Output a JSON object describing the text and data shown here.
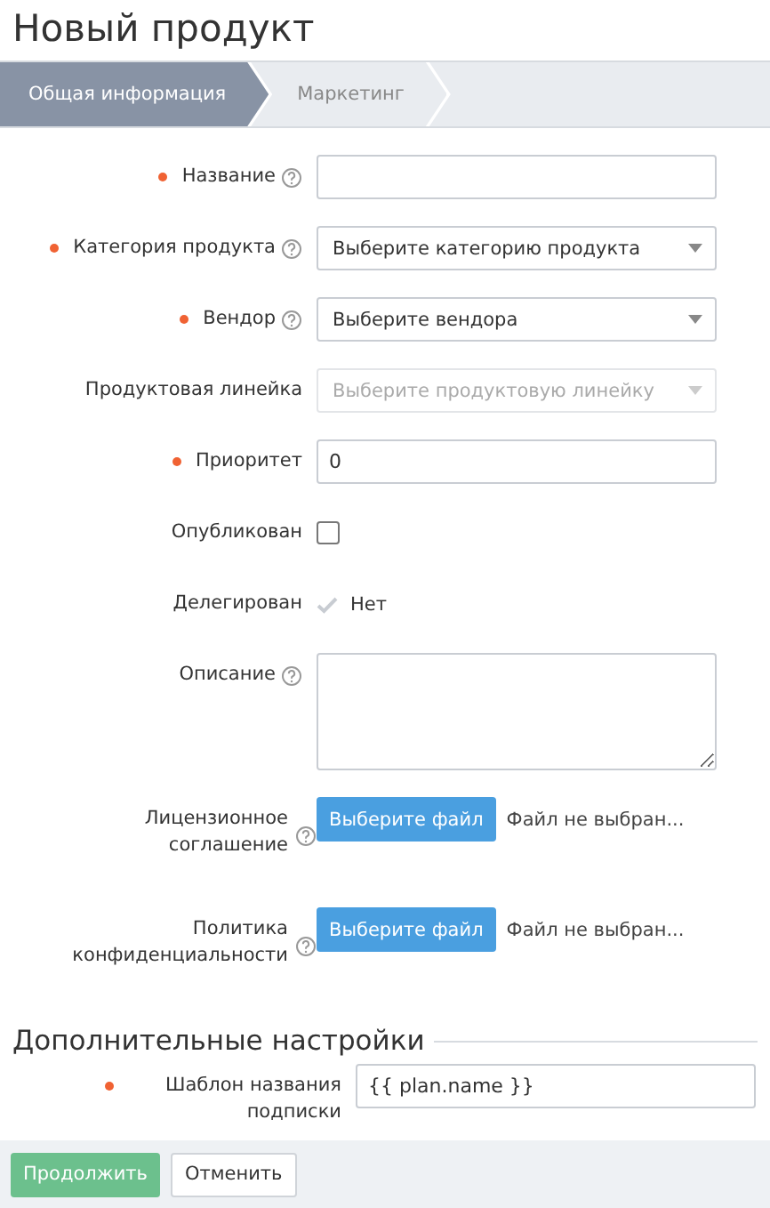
{
  "title": "Новый продукт",
  "steps": [
    {
      "label": "Общая информация",
      "selected": true
    },
    {
      "label": "Маркетинг",
      "selected": false
    }
  ],
  "fields": [
    {
      "kind": "text",
      "label": "Название",
      "required": true,
      "help": true
    },
    {
      "kind": "select",
      "label": "Категория продукта",
      "required": true,
      "help": true,
      "placeholder": "Выберите категорию продукта",
      "disabled": false
    },
    {
      "kind": "select",
      "label": "Вендор",
      "required": true,
      "help": true,
      "placeholder": "Выберите вендора",
      "disabled": false
    },
    {
      "kind": "select",
      "label": "Продуктовая линейка",
      "required": false,
      "help": false,
      "placeholder": "Выберите продуктовую линейку",
      "disabled": true
    },
    {
      "kind": "text",
      "label": "Приоритет",
      "required": true,
      "help": false,
      "value": "0"
    },
    {
      "kind": "checkbox",
      "label": "Опубликован",
      "required": false,
      "help": false,
      "checked": false
    },
    {
      "kind": "status",
      "label": "Делегирован",
      "required": false,
      "help": false,
      "value": "Нет"
    },
    {
      "kind": "textarea",
      "label": "Описание",
      "required": false,
      "help": true
    },
    {
      "kind": "file",
      "label": "Лицензионное соглашение",
      "required": false,
      "help": true,
      "button": "Выберите файл",
      "status": "Файл не выбран..."
    },
    {
      "kind": "file",
      "label": "Политика конфиденциальности",
      "required": false,
      "help": true,
      "button": "Выберите файл",
      "status": "Файл не выбран..."
    }
  ],
  "section": {
    "title": "Дополнительные настройки",
    "fields": [
      {
        "kind": "text",
        "label": "Шаблон названия подписки",
        "required": true,
        "help": false,
        "value": "{{ plan.name }}"
      }
    ]
  },
  "buttons": [
    {
      "label": "Продолжить",
      "kind": "primary"
    },
    {
      "label": "Отменить",
      "kind": "secondary"
    }
  ]
}
